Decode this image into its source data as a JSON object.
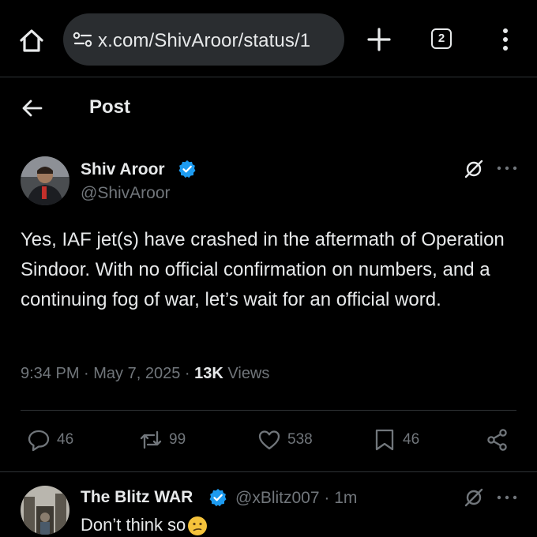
{
  "browser": {
    "url": "x.com/ShivAroor/status/1",
    "tab_count": "2",
    "icons": [
      "home-icon",
      "site-info-icon",
      "plus-icon",
      "tabs-icon",
      "overflow-menu-icon"
    ]
  },
  "header": {
    "title": "Post",
    "icons": [
      "back-arrow-icon"
    ]
  },
  "post": {
    "author_name": "Shiv Aroor",
    "handle": "@ShivAroor",
    "text": "Yes, IAF jet(s) have crashed in the aftermath of Operation Sindoor. With no official confirmation on numbers, and a continuing fog of war, let’s wait for an official word.",
    "time": "9:34 PM",
    "date": "May 7, 2025",
    "views_count": "13K",
    "views_label": "Views",
    "actions": {
      "replies": "46",
      "reposts": "99",
      "likes": "538",
      "bookmarks": "46"
    }
  },
  "reply": {
    "author_name": "The Blitz WAR",
    "handle": "@xBlitz007",
    "time": "1m",
    "text": "Don’t think so"
  },
  "colors": {
    "background": "#000000",
    "text": "#e7e9ea",
    "secondary_text": "#71767b",
    "verified_blue": "#1d9bf0",
    "divider": "#2f3336"
  }
}
